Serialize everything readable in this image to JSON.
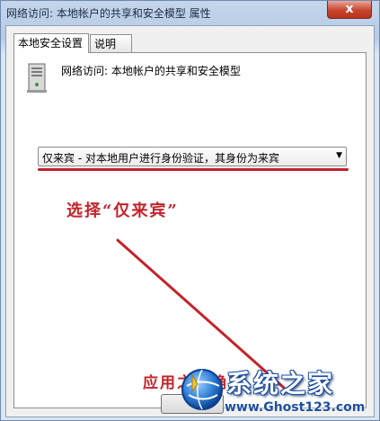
{
  "window": {
    "title": "网络访问: 本地帐户的共享和安全模型 属性",
    "close_label": "x"
  },
  "tabs": [
    {
      "label": "本地安全设置",
      "active": true
    },
    {
      "label": "说明",
      "active": false
    }
  ],
  "policy": {
    "name": "网络访问: 本地帐户的共享和安全模型",
    "icon": "server-icon"
  },
  "dropdown": {
    "selected": "仅来宾 - 对本地用户进行身份验证，其身份为来宾",
    "arrow": "▼"
  },
  "annotations": {
    "select_hint": "选择“仅来宾”",
    "apply_hint": "应用之后确定",
    "color": "#c3232a"
  },
  "watermark": {
    "brand": "系统之家",
    "url": "www.Ghost123.com"
  }
}
